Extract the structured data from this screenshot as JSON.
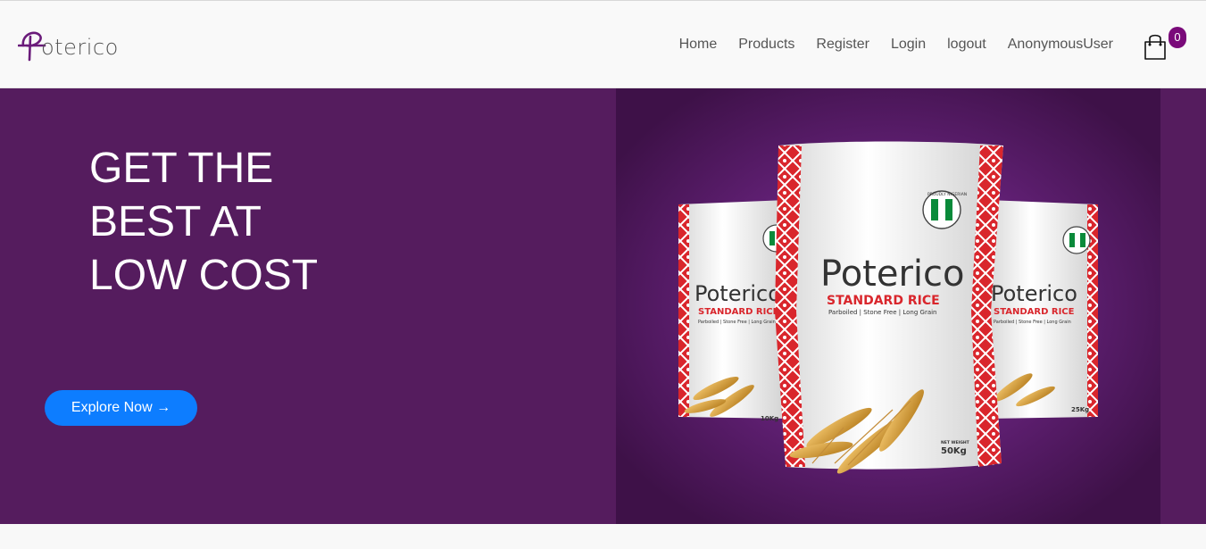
{
  "brand": {
    "name": "Poterico"
  },
  "nav": {
    "items": [
      {
        "label": "Home"
      },
      {
        "label": "Products"
      },
      {
        "label": "Register"
      },
      {
        "label": "Login"
      },
      {
        "label": "logout"
      },
      {
        "label": "AnonymousUser"
      }
    ],
    "cart_icon": "shopping-bag-icon",
    "cart_count": "0"
  },
  "hero": {
    "title": "GET THE BEST AT LOW COST",
    "cta_label": "Explore Now →",
    "product": {
      "brand": "Poterico",
      "name": "STANDARD RICE",
      "tagline": "Parboiled | Stone Free | Long Grain",
      "badge": "PROUDLY NIGERIAN",
      "weight_center": "50Kg",
      "weight_right": "25Kg",
      "weight_left": "10Kg",
      "net_weight_label": "NET WEIGHT"
    }
  },
  "colors": {
    "brand_purple": "#551c5e",
    "accent_purple": "#7a0a7a",
    "cta_blue": "#0d7dff",
    "bag_red": "#d9262c"
  }
}
